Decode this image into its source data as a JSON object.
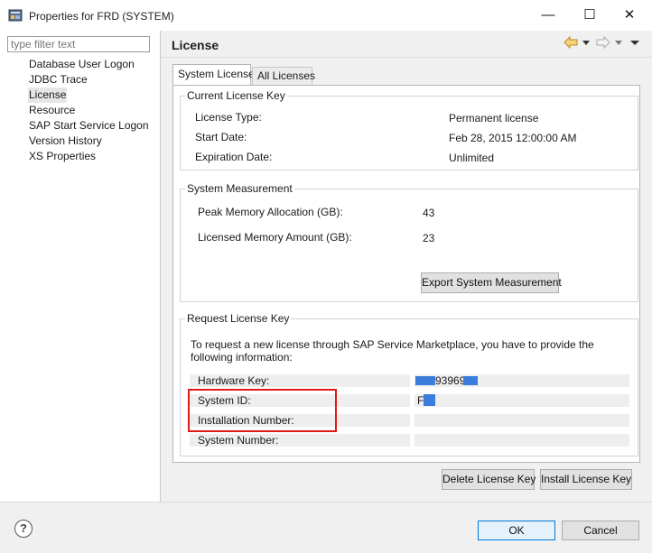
{
  "window": {
    "title": "Properties for FRD (SYSTEM)",
    "minimize_glyph": "—",
    "maximize_glyph": "☐",
    "close_glyph": "✕"
  },
  "sidebar": {
    "filter_placeholder": "type filter text",
    "items": [
      {
        "label": "Database User Logon",
        "selected": false
      },
      {
        "label": "JDBC Trace",
        "selected": false
      },
      {
        "label": "License",
        "selected": true
      },
      {
        "label": "Resource",
        "selected": false
      },
      {
        "label": "SAP Start Service Logon",
        "selected": false
      },
      {
        "label": "Version History",
        "selected": false
      },
      {
        "label": "XS Properties",
        "selected": false
      }
    ]
  },
  "page": {
    "title": "License",
    "nav_icons": [
      "back-arrow-icon",
      "dropdown-icon",
      "forward-arrow-icon",
      "dropdown-icon",
      "view-menu-icon"
    ]
  },
  "tabs": [
    {
      "label": "System License",
      "active": true
    },
    {
      "label": "All Licenses",
      "active": false
    }
  ],
  "current_license": {
    "title": "Current License Key",
    "rows": [
      {
        "label": "License Type:",
        "value": "Permanent license"
      },
      {
        "label": "Start Date:",
        "value": "Feb 28, 2015 12:00:00 AM"
      },
      {
        "label": "Expiration Date:",
        "value": "Unlimited"
      }
    ]
  },
  "system_measurement": {
    "title": "System Measurement",
    "rows": [
      {
        "label": "Peak Memory Allocation (GB):",
        "value": "43"
      },
      {
        "label": "Licensed Memory Amount (GB):",
        "value": "23"
      }
    ],
    "export_button": "Export System Measurement"
  },
  "request_license": {
    "title": "Request License Key",
    "intro": "To request a new license through SAP Service Marketplace, you have to provide the following information:",
    "rows": [
      {
        "label": "Hardware Key:",
        "value": "93969"
      },
      {
        "label": "System ID:",
        "value": "F"
      },
      {
        "label": "Installation Number:",
        "value": ""
      },
      {
        "label": "System Number:",
        "value": ""
      }
    ]
  },
  "actions": {
    "delete_key": "Delete License Key",
    "install_key": "Install License Key"
  },
  "footer": {
    "help_glyph": "?",
    "ok": "OK",
    "cancel": "Cancel"
  },
  "colors": {
    "highlight": "#e01919",
    "redaction": "#3b7ddb",
    "ok_border": "#0078d7"
  }
}
